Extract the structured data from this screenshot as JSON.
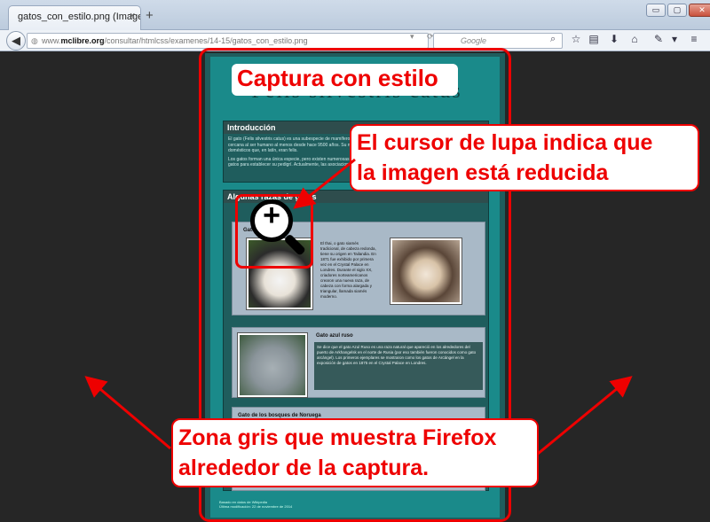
{
  "browser": {
    "tab_title": "gatos_con_estilo.png (Imagen ...",
    "tab_close": "×",
    "new_tab": "+",
    "window_controls": {
      "minimize": "▭",
      "maximize": "▢",
      "close": "✕"
    },
    "url_prefix": "www.",
    "url_domain": "mclibre.org",
    "url_path": "/consultar/htmlcss/examenes/14-15/gatos_con_estilo.png",
    "search_placeholder": "Google",
    "search_engine_letter": "8"
  },
  "capture": {
    "page_heading": "Félis silvestris catus",
    "intro_heading": "Introducción",
    "intro_p1": "El gato (Felis silvestris catus) es una subespecie de mamífero carnívoro de la familia Felidae. El gato está en convivencia cercana al ser humano al menos desde hace 9500 años. Su nombre deriva del latín tardío cattus, en contraposición a los gatos domésticos que, en latín, eran felis.",
    "intro_p2": "Los gatos forman una única especie, pero existen numerosas razas de gatos. En 1887 se fundó en Inglaterra el primer registro de gatos para establecer su pedigrí. Actualmente, las asociaciones tienen registradas de 37 palabras distintas.",
    "breeds_heading": "Algunas razas de gatos",
    "breeds": [
      {
        "name": "Gato siamés",
        "text": "El thai, o gato siamés tradicional, de cabeza redonda, tiene su origen en Tailandia. En 1871 fue exhibido por primera vez en el Crystal Palace en Londres. Durante el siglo XX, criadores norteamericanos crearon una nueva raza, de cabeza con forma alargada y triangular, llamada siamés moderno."
      },
      {
        "name": "Gato azul ruso",
        "text": "Se dice que el gato Azul Ruso es una raza natural que apareció en los alrededores del puerto de Arkhangelsk en el norte de Rusia (por eso también fueron conocidos como gato arcángel). Los primeros ejemplares se mostraron como los gatos de Arcángel en la exposición de gatos en 1875 en el Crystal Palace en Londres."
      },
      {
        "name": "Gato de los bosques de Noruega",
        "text": ""
      }
    ],
    "footer_line1": "Basado en datos de Wikipedia",
    "footer_line2": "Última modificación: 22 de noviembre de 2014"
  },
  "annotations": {
    "title": "Captura con estilo",
    "zoom_line1": "El cursor de lupa indica que",
    "zoom_line2": "la imagen está reducida",
    "gray_line1": "Zona gris que muestra Firefox",
    "gray_line2": "alrededor de la captura.",
    "magnifier_symbol": "+",
    "color": "#e00000"
  },
  "icons": {
    "back": "back-arrow-icon",
    "globe": "globe-icon",
    "star": "star-icon",
    "home": "home-icon",
    "menu": "hamburger-menu-icon"
  }
}
